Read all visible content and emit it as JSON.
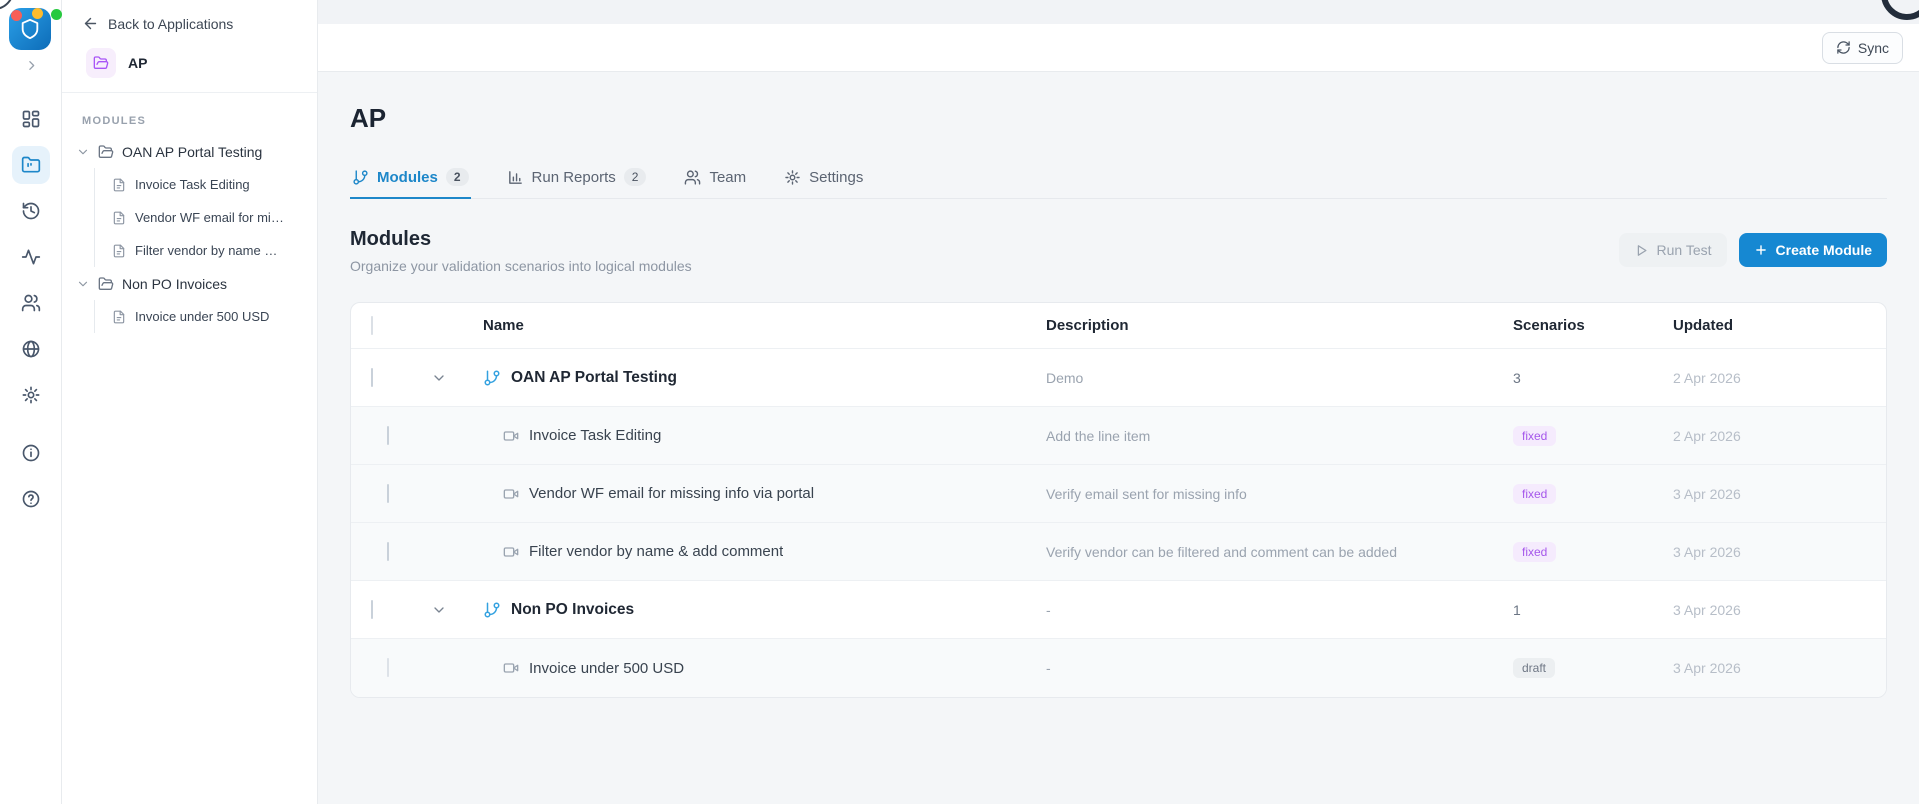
{
  "window": {
    "sync_label": "Sync"
  },
  "rail": {
    "icons": [
      "dashboard-grid",
      "projects-folder",
      "history",
      "activity",
      "team",
      "globe",
      "settings",
      "info",
      "help"
    ],
    "active_icon": "projects-folder"
  },
  "sidebar": {
    "back_label": "Back to Applications",
    "app_name": "AP",
    "section_label": "MODULES",
    "tree": [
      {
        "label": "OAN AP Portal Testing",
        "children": [
          "Invoice Task Editing",
          "Vendor WF email for missing info via portal",
          "Filter vendor by name & add comment"
        ]
      },
      {
        "label": "Non PO Invoices",
        "children": [
          "Invoice under 500 USD"
        ]
      }
    ]
  },
  "main": {
    "title": "AP",
    "tabs": [
      {
        "label": "Modules",
        "count": "2",
        "active": true,
        "icon": "git-branch-icon"
      },
      {
        "label": "Run Reports",
        "count": "2",
        "active": false,
        "icon": "bar-chart-icon"
      },
      {
        "label": "Team",
        "active": false,
        "icon": "users-icon"
      },
      {
        "label": "Settings",
        "active": false,
        "icon": "gear-icon"
      }
    ],
    "section": {
      "heading": "Modules",
      "subheading": "Organize your validation scenarios into logical modules"
    },
    "actions": {
      "run_test": "Run Test",
      "create_module": "Create Module"
    },
    "table": {
      "columns": [
        "Name",
        "Description",
        "Scenarios",
        "Updated"
      ],
      "rows": [
        {
          "kind": "module",
          "name": "OAN AP Portal Testing",
          "description": "Demo",
          "scenarios": "3",
          "updated": "2 Apr 2026"
        },
        {
          "kind": "scenario",
          "name": "Invoice Task Editing",
          "description": "Add the line item",
          "badge": "fixed",
          "updated": "2 Apr 2026"
        },
        {
          "kind": "scenario",
          "name": "Vendor WF email for missing info via portal",
          "description": "Verify email sent for missing info",
          "badge": "fixed",
          "updated": "3 Apr 2026"
        },
        {
          "kind": "scenario",
          "name": "Filter vendor by name & add comment",
          "description": "Verify vendor can be filtered and comment can be added",
          "badge": "fixed",
          "updated": "3 Apr 2026"
        },
        {
          "kind": "module",
          "name": "Non PO Invoices",
          "description": "-",
          "scenarios": "1",
          "updated": "3 Apr 2026"
        },
        {
          "kind": "scenario",
          "name": "Invoice under 500 USD",
          "description": "-",
          "badge": "draft",
          "disabled": true,
          "updated": "3 Apr 2026"
        }
      ]
    }
  },
  "colors": {
    "accent_blue": "#1d87c9",
    "button_blue": "#1688d2",
    "badge_purple": "#a557eb",
    "active_rail_bg": "#e6f2fb"
  }
}
